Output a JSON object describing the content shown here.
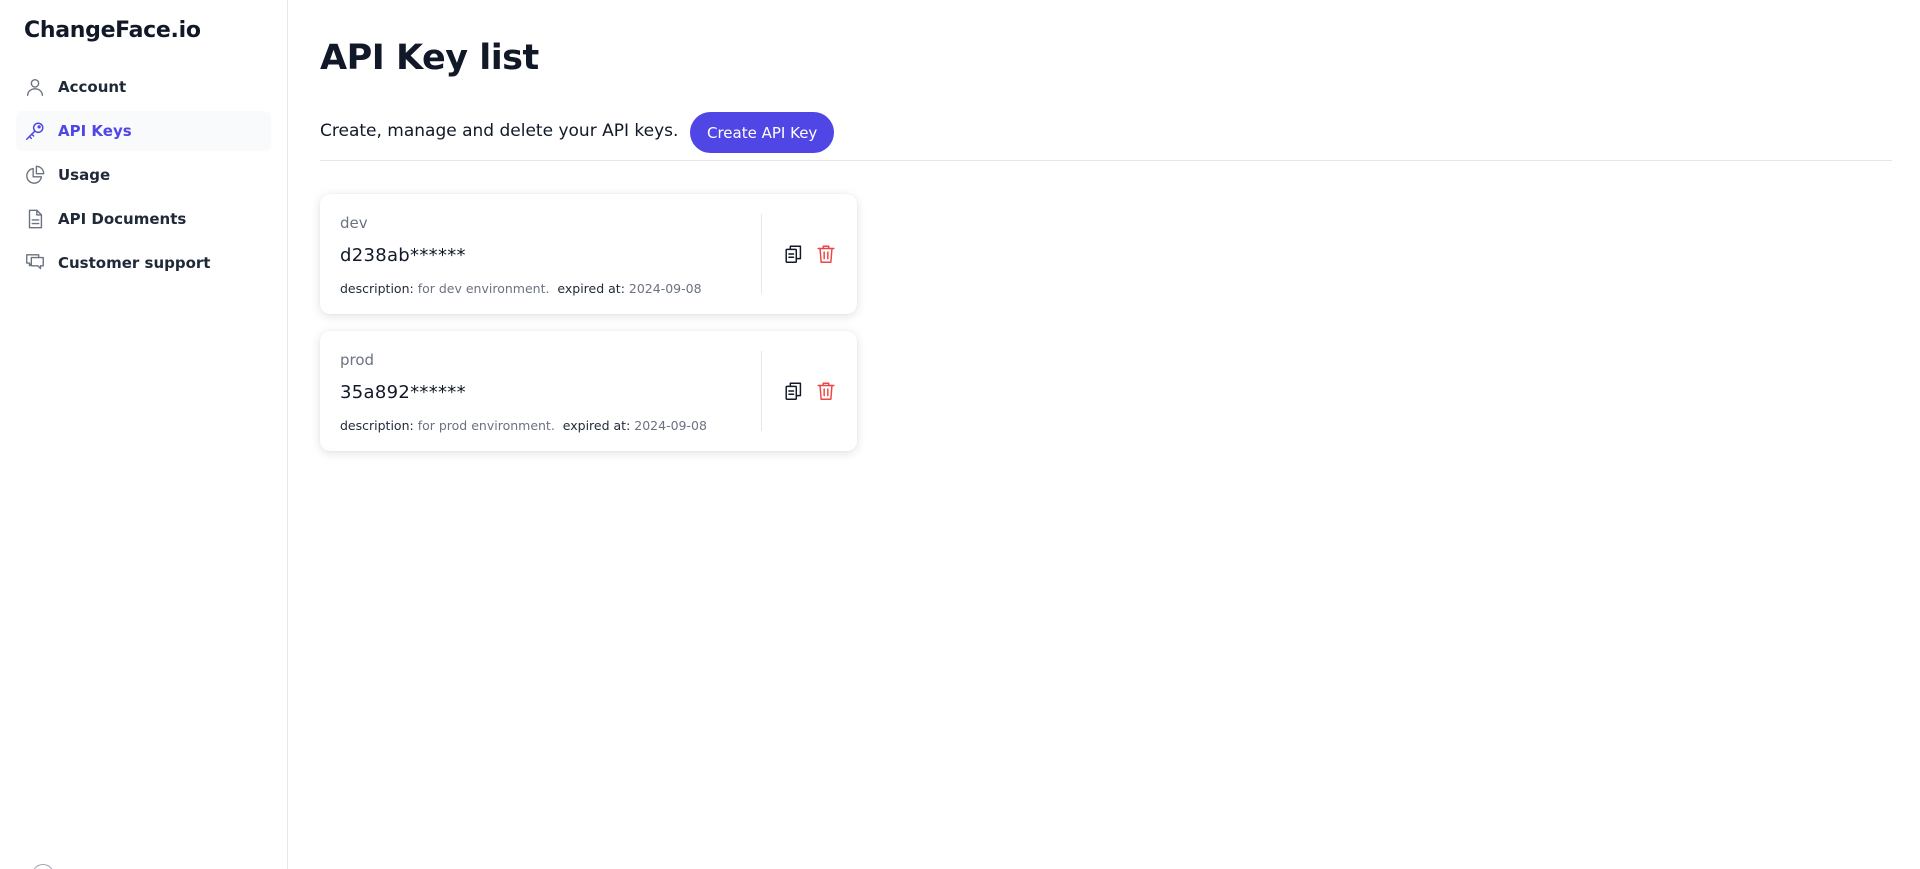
{
  "brand": "ChangeFace.io",
  "sidebar": {
    "items": [
      {
        "label": "Account",
        "icon": "user-icon",
        "active": false
      },
      {
        "label": "API Keys",
        "icon": "key-icon",
        "active": true
      },
      {
        "label": "Usage",
        "icon": "pie-chart-icon",
        "active": false
      },
      {
        "label": "API Documents",
        "icon": "document-icon",
        "active": false
      },
      {
        "label": "Customer support",
        "icon": "chat-icon",
        "active": false
      }
    ]
  },
  "main": {
    "title": "API Key list",
    "subtitle": "Create, manage and delete your API keys.",
    "create_button": "Create API Key",
    "keys": [
      {
        "name": "dev",
        "value": "d238ab******",
        "description_label": "description:",
        "description": "for dev environment.",
        "expired_label": "expired at:",
        "expired_at": "2024-09-08"
      },
      {
        "name": "prod",
        "value": "35a892******",
        "description_label": "description:",
        "description": "for prod environment.",
        "expired_label": "expired at:",
        "expired_at": "2024-09-08"
      }
    ]
  },
  "colors": {
    "accent": "#4f46e5",
    "danger": "#ef4444",
    "muted": "#6b7280"
  }
}
